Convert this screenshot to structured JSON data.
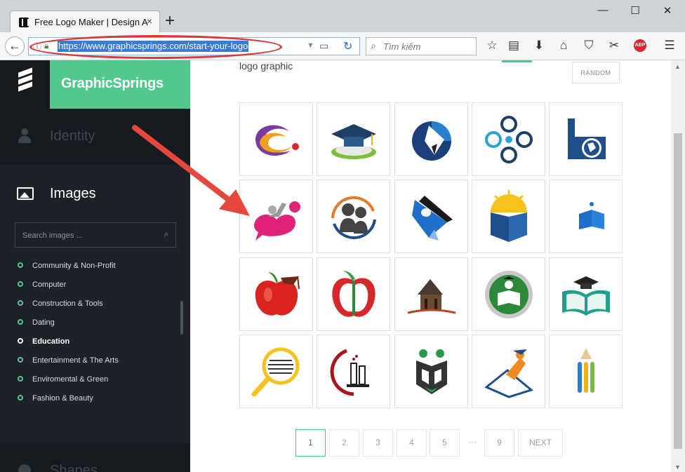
{
  "browser": {
    "tab_title": "Free Logo Maker | Design A",
    "tab_close": "×",
    "new_tab": "+",
    "window_controls": {
      "minimize": "—",
      "maximize": "☐",
      "close": "✕"
    },
    "back": "←",
    "url": "https://www.graphicsprings.com/start-your-logo",
    "search_placeholder": "Tìm kiếm",
    "adblock_label": "ABP",
    "toolbar_icons": [
      "star-icon",
      "clipboard-icon",
      "download-icon",
      "home-icon",
      "pocket-icon",
      "extension-icon",
      "adblock-icon",
      "menu-icon"
    ]
  },
  "sidebar": {
    "brand": "GraphicSprings",
    "identity_label": "Identity",
    "images_label": "Images",
    "search_placeholder": "Search images ...",
    "categories": [
      {
        "label": "Community & Non-Profit",
        "active": false
      },
      {
        "label": "Computer",
        "active": false
      },
      {
        "label": "Construction & Tools",
        "active": false
      },
      {
        "label": "Dating",
        "active": false
      },
      {
        "label": "Education",
        "active": true
      },
      {
        "label": "Entertainment & The Arts",
        "active": false
      },
      {
        "label": "Enviromental & Green",
        "active": false
      },
      {
        "label": "Fashion & Beauty",
        "active": false
      }
    ],
    "shapes_label": "Shapes"
  },
  "main": {
    "section_label": "logo graphic",
    "random_button": "RANDOM",
    "logos": [
      "orbit-swoosh-logo",
      "graduation-cap-logo",
      "pen-nib-logo",
      "people-circle-logo",
      "building-globe-logo",
      "student-heart-logo",
      "two-people-logo",
      "flag-book-logo",
      "sunrise-book-logo",
      "open-book-crescent-logo",
      "apple-cap-logo",
      "apple-book-logo",
      "schoolhouse-logo",
      "globe-reader-logo",
      "cap-open-book-logo",
      "magnifier-logo",
      "test-tube-logo",
      "book-mask-logo",
      "graduate-paper-logo",
      "pencil-bars-logo"
    ],
    "pagination": [
      "1",
      "2",
      "3",
      "4",
      "5",
      "···",
      "9",
      "NEXT"
    ],
    "current_page": "1"
  },
  "colors": {
    "accent_green": "#52c78e",
    "sidebar_bg": "#1c2228",
    "annotation_red": "#d7383b",
    "url_highlight": "#3a7bd5"
  }
}
